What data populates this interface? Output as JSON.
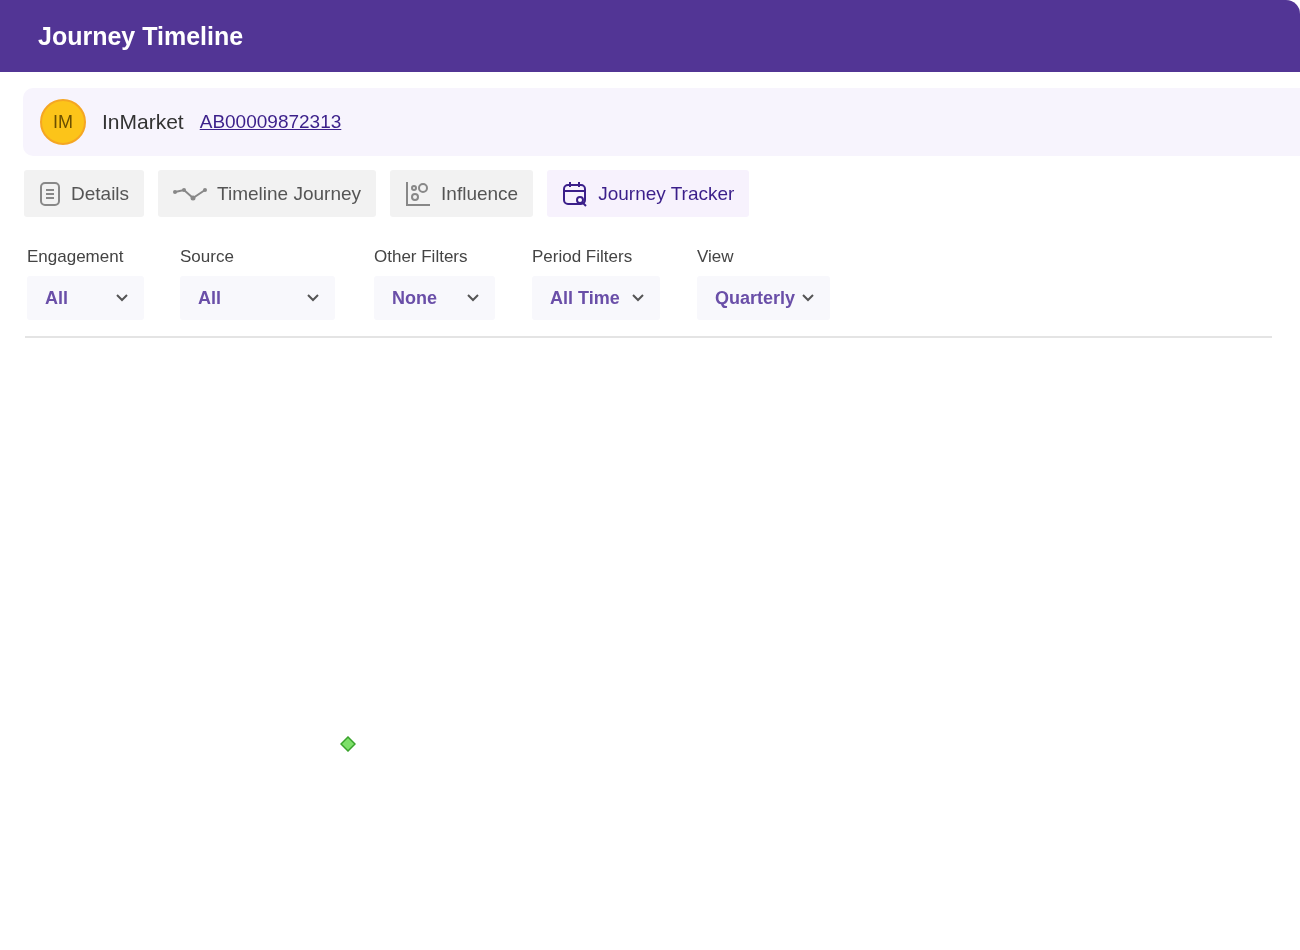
{
  "header": {
    "title": "Journey Timeline"
  },
  "account": {
    "initials": "IM",
    "name": "InMarket",
    "id_link": "AB00009872313"
  },
  "tabs": [
    {
      "kind": "details",
      "label": "Details",
      "selected": false
    },
    {
      "kind": "timeline",
      "label": "Timeline Journey",
      "selected": false
    },
    {
      "kind": "influence",
      "label": "Influence",
      "selected": false
    },
    {
      "kind": "tracker",
      "label": "Journey Tracker",
      "selected": true
    }
  ],
  "filters": [
    {
      "label": "Engagement",
      "value": "All"
    },
    {
      "label": "Source",
      "value": "All"
    },
    {
      "label": "Other Filters",
      "value": "None"
    },
    {
      "label": "Period Filters",
      "value": "All Time"
    },
    {
      "label": "View",
      "value": "Quarterly"
    }
  ]
}
